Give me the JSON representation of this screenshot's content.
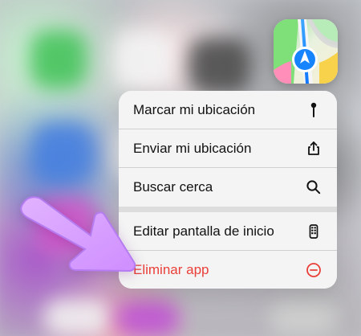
{
  "screen": {
    "app_icon_name": "map-icon",
    "accent_color": "#ea3f38"
  },
  "menu": {
    "items": [
      {
        "label": "Marcar mi ubicación",
        "icon": "pin-icon"
      },
      {
        "label": "Enviar mi ubicación",
        "icon": "share-icon"
      },
      {
        "label": "Buscar cerca",
        "icon": "search-icon"
      },
      {
        "label": "Editar pantalla de inicio",
        "icon": "phone-icon"
      },
      {
        "label": "Eliminar app",
        "icon": "minus-circle-icon"
      }
    ]
  },
  "annotation": {
    "arrow_color": "#d59cff",
    "arrow_shadow_color": "#b57cf2"
  }
}
